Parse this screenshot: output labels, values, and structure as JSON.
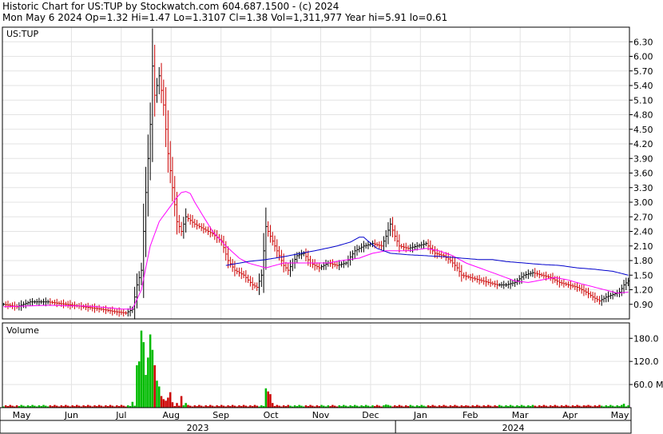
{
  "header": {
    "line1": "Historic Chart for US:TUP by Stockwatch.com 604.687.1500 - (c) 2024",
    "line2": "Mon May  6 2024  Op=1.32  Hi=1.47  Lo=1.3107  Cl=1.38  Vol=1,311,977  Year hi=5.91  lo=0.61"
  },
  "colors": {
    "up": "#000000",
    "down": "#cc0000",
    "ma_short": "#ff00ff",
    "ma_long": "#0000cc",
    "vol_up": "#00bb00",
    "vol_down": "#cc0000"
  },
  "chart_data": {
    "type": "line",
    "symbol": "US:TUP",
    "price_axis": {
      "ticks": [
        "6.30",
        "6.00",
        "5.70",
        "5.40",
        "5.10",
        "4.80",
        "4.50",
        "4.20",
        "3.90",
        "3.60",
        "3.30",
        "3.00",
        "2.70",
        "2.40",
        "2.10",
        "1.80",
        "1.50",
        "1.20",
        "0.90"
      ],
      "ylim": [
        0.6,
        6.6
      ]
    },
    "volume_panel": {
      "label": "Volume",
      "ticks": [
        "180.0",
        "120.0",
        "60.0 M"
      ],
      "ylim": [
        0,
        220
      ]
    },
    "x_axis": {
      "months": [
        "May",
        "Jun",
        "Jul",
        "Aug",
        "Sep",
        "Oct",
        "Nov",
        "Dec",
        "Jan",
        "Feb",
        "Mar",
        "Apr",
        "May"
      ],
      "years": [
        "2023",
        "2024"
      ]
    },
    "price_anchors": [
      [
        0,
        0.9
      ],
      [
        6,
        0.85
      ],
      [
        12,
        0.95
      ],
      [
        20,
        0.95
      ],
      [
        28,
        0.9
      ],
      [
        36,
        0.85
      ],
      [
        44,
        0.8
      ],
      [
        50,
        0.75
      ],
      [
        55,
        0.72
      ],
      [
        58,
        0.8
      ],
      [
        60,
        1.3
      ],
      [
        62,
        1.6
      ],
      [
        64,
        3.2
      ],
      [
        66,
        4.6
      ],
      [
        67,
        5.8
      ],
      [
        68,
        5.2
      ],
      [
        70,
        5.6
      ],
      [
        72,
        5.0
      ],
      [
        74,
        4.0
      ],
      [
        76,
        3.3
      ],
      [
        78,
        2.6
      ],
      [
        80,
        2.4
      ],
      [
        82,
        2.7
      ],
      [
        86,
        2.55
      ],
      [
        90,
        2.45
      ],
      [
        94,
        2.35
      ],
      [
        98,
        2.2
      ],
      [
        101,
        1.8
      ],
      [
        104,
        1.6
      ],
      [
        108,
        1.5
      ],
      [
        112,
        1.3
      ],
      [
        114,
        1.25
      ],
      [
        116,
        1.5
      ],
      [
        118,
        2.5
      ],
      [
        120,
        2.3
      ],
      [
        122,
        2.1
      ],
      [
        124,
        1.9
      ],
      [
        126,
        1.7
      ],
      [
        128,
        1.6
      ],
      [
        132,
        1.9
      ],
      [
        135,
        1.95
      ],
      [
        138,
        1.75
      ],
      [
        142,
        1.65
      ],
      [
        146,
        1.75
      ],
      [
        150,
        1.7
      ],
      [
        154,
        1.75
      ],
      [
        158,
        2.0
      ],
      [
        162,
        2.1
      ],
      [
        166,
        2.15
      ],
      [
        170,
        2.1
      ],
      [
        172,
        2.3
      ],
      [
        174,
        2.55
      ],
      [
        176,
        2.3
      ],
      [
        178,
        2.1
      ],
      [
        182,
        2.05
      ],
      [
        186,
        2.1
      ],
      [
        190,
        2.15
      ],
      [
        194,
        1.95
      ],
      [
        198,
        1.9
      ],
      [
        201,
        1.8
      ],
      [
        204,
        1.65
      ],
      [
        206,
        1.5
      ],
      [
        210,
        1.45
      ],
      [
        214,
        1.4
      ],
      [
        218,
        1.35
      ],
      [
        222,
        1.3
      ],
      [
        226,
        1.3
      ],
      [
        230,
        1.35
      ],
      [
        234,
        1.5
      ],
      [
        238,
        1.55
      ],
      [
        242,
        1.5
      ],
      [
        246,
        1.45
      ],
      [
        250,
        1.35
      ],
      [
        254,
        1.3
      ],
      [
        258,
        1.25
      ],
      [
        262,
        1.15
      ],
      [
        265,
        1.05
      ],
      [
        268,
        0.97
      ],
      [
        271,
        1.05
      ],
      [
        274,
        1.1
      ],
      [
        277,
        1.15
      ],
      [
        279,
        1.3
      ],
      [
        281,
        1.38
      ]
    ],
    "ma_short_anchors": [
      [
        0,
        0.85
      ],
      [
        20,
        0.88
      ],
      [
        40,
        0.86
      ],
      [
        54,
        0.8
      ],
      [
        58,
        0.8
      ],
      [
        62,
        1.2
      ],
      [
        66,
        2.1
      ],
      [
        70,
        2.6
      ],
      [
        74,
        2.85
      ],
      [
        78,
        3.1
      ],
      [
        80,
        3.2
      ],
      [
        82,
        3.22
      ],
      [
        84,
        3.18
      ],
      [
        86,
        3.0
      ],
      [
        90,
        2.7
      ],
      [
        94,
        2.4
      ],
      [
        100,
        2.1
      ],
      [
        106,
        1.85
      ],
      [
        110,
        1.75
      ],
      [
        114,
        1.7
      ],
      [
        118,
        1.65
      ],
      [
        122,
        1.7
      ],
      [
        126,
        1.75
      ],
      [
        132,
        1.75
      ],
      [
        138,
        1.75
      ],
      [
        146,
        1.75
      ],
      [
        152,
        1.8
      ],
      [
        160,
        1.85
      ],
      [
        166,
        1.95
      ],
      [
        172,
        2.0
      ],
      [
        176,
        2.0
      ],
      [
        182,
        2.0
      ],
      [
        190,
        2.05
      ],
      [
        196,
        2.0
      ],
      [
        202,
        1.9
      ],
      [
        208,
        1.75
      ],
      [
        214,
        1.65
      ],
      [
        220,
        1.55
      ],
      [
        226,
        1.45
      ],
      [
        230,
        1.38
      ],
      [
        236,
        1.35
      ],
      [
        242,
        1.4
      ],
      [
        248,
        1.45
      ],
      [
        254,
        1.4
      ],
      [
        260,
        1.32
      ],
      [
        266,
        1.25
      ],
      [
        272,
        1.18
      ],
      [
        276,
        1.13
      ],
      [
        281,
        1.15
      ]
    ],
    "ma_long_anchors": [
      [
        100,
        1.7
      ],
      [
        110,
        1.78
      ],
      [
        118,
        1.82
      ],
      [
        126,
        1.88
      ],
      [
        134,
        1.95
      ],
      [
        142,
        2.02
      ],
      [
        150,
        2.1
      ],
      [
        156,
        2.18
      ],
      [
        160,
        2.28
      ],
      [
        162,
        2.28
      ],
      [
        164,
        2.2
      ],
      [
        168,
        2.05
      ],
      [
        174,
        1.95
      ],
      [
        182,
        1.92
      ],
      [
        190,
        1.9
      ],
      [
        198,
        1.88
      ],
      [
        206,
        1.85
      ],
      [
        214,
        1.82
      ],
      [
        220,
        1.82
      ],
      [
        226,
        1.78
      ],
      [
        234,
        1.75
      ],
      [
        242,
        1.72
      ],
      [
        250,
        1.7
      ],
      [
        258,
        1.65
      ],
      [
        266,
        1.62
      ],
      [
        274,
        1.58
      ],
      [
        281,
        1.5
      ]
    ],
    "volume_spikes": [
      [
        58,
        15
      ],
      [
        60,
        110
      ],
      [
        61,
        120
      ],
      [
        62,
        200
      ],
      [
        63,
        170
      ],
      [
        64,
        85
      ],
      [
        65,
        130
      ],
      [
        66,
        190
      ],
      [
        67,
        150
      ],
      [
        68,
        110
      ],
      [
        69,
        70
      ],
      [
        70,
        55
      ],
      [
        71,
        30
      ],
      [
        72,
        22
      ],
      [
        73,
        18
      ],
      [
        74,
        26
      ],
      [
        75,
        40
      ],
      [
        76,
        14
      ],
      [
        78,
        12
      ],
      [
        80,
        30
      ],
      [
        82,
        12
      ],
      [
        118,
        50
      ],
      [
        119,
        42
      ],
      [
        120,
        35
      ],
      [
        121,
        12
      ],
      [
        172,
        8
      ],
      [
        208,
        6
      ],
      [
        262,
        5
      ],
      [
        279,
        10
      ]
    ]
  }
}
